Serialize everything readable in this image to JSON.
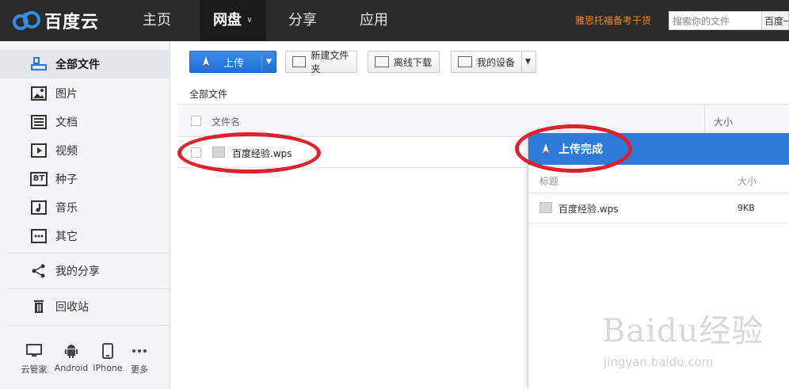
{
  "header": {
    "logo_text": "百度云",
    "nav": [
      {
        "label": "主页"
      },
      {
        "label": "网盘"
      },
      {
        "label": "分享"
      },
      {
        "label": "应用"
      }
    ],
    "promo": "雅思托福备考干货",
    "search": {
      "placeholder": "搜索你的文件",
      "scope": "百度一"
    }
  },
  "sidebar": {
    "items": [
      {
        "label": "全部文件",
        "icon": "folder-icon"
      },
      {
        "label": "图片",
        "icon": "image-icon"
      },
      {
        "label": "文档",
        "icon": "document-icon"
      },
      {
        "label": "视频",
        "icon": "video-icon"
      },
      {
        "label": "种子",
        "icon": "bt-icon",
        "icon_text": "BT"
      },
      {
        "label": "音乐",
        "icon": "music-icon"
      },
      {
        "label": "其它",
        "icon": "more-icon"
      },
      {
        "label": "我的分享",
        "icon": "share-icon"
      },
      {
        "label": "回收站",
        "icon": "trash-icon"
      }
    ],
    "devices": [
      {
        "label": "云管家",
        "icon": "monitor-icon"
      },
      {
        "label": "Android",
        "icon": "android-icon"
      },
      {
        "label": "iPhone",
        "icon": "phone-icon"
      },
      {
        "label": "更多",
        "icon": "ellipsis-icon"
      }
    ]
  },
  "toolbar": {
    "upload_label": "上传",
    "new_folder_label": "新建文件夹",
    "offline_label": "离线下载",
    "devices_label": "我的设备"
  },
  "main": {
    "breadcrumb": "全部文件",
    "columns": {
      "name": "文件名",
      "size": "大小"
    },
    "files": [
      {
        "name": "百度经验.wps"
      }
    ]
  },
  "upload_panel": {
    "title": "上传完成",
    "columns": {
      "title": "标题",
      "size": "大小"
    },
    "items": [
      {
        "name": "百度经验.wps",
        "size": "9KB"
      }
    ]
  },
  "watermark": {
    "text": "Baidu经验",
    "url": "jingyan.baidu.com"
  }
}
